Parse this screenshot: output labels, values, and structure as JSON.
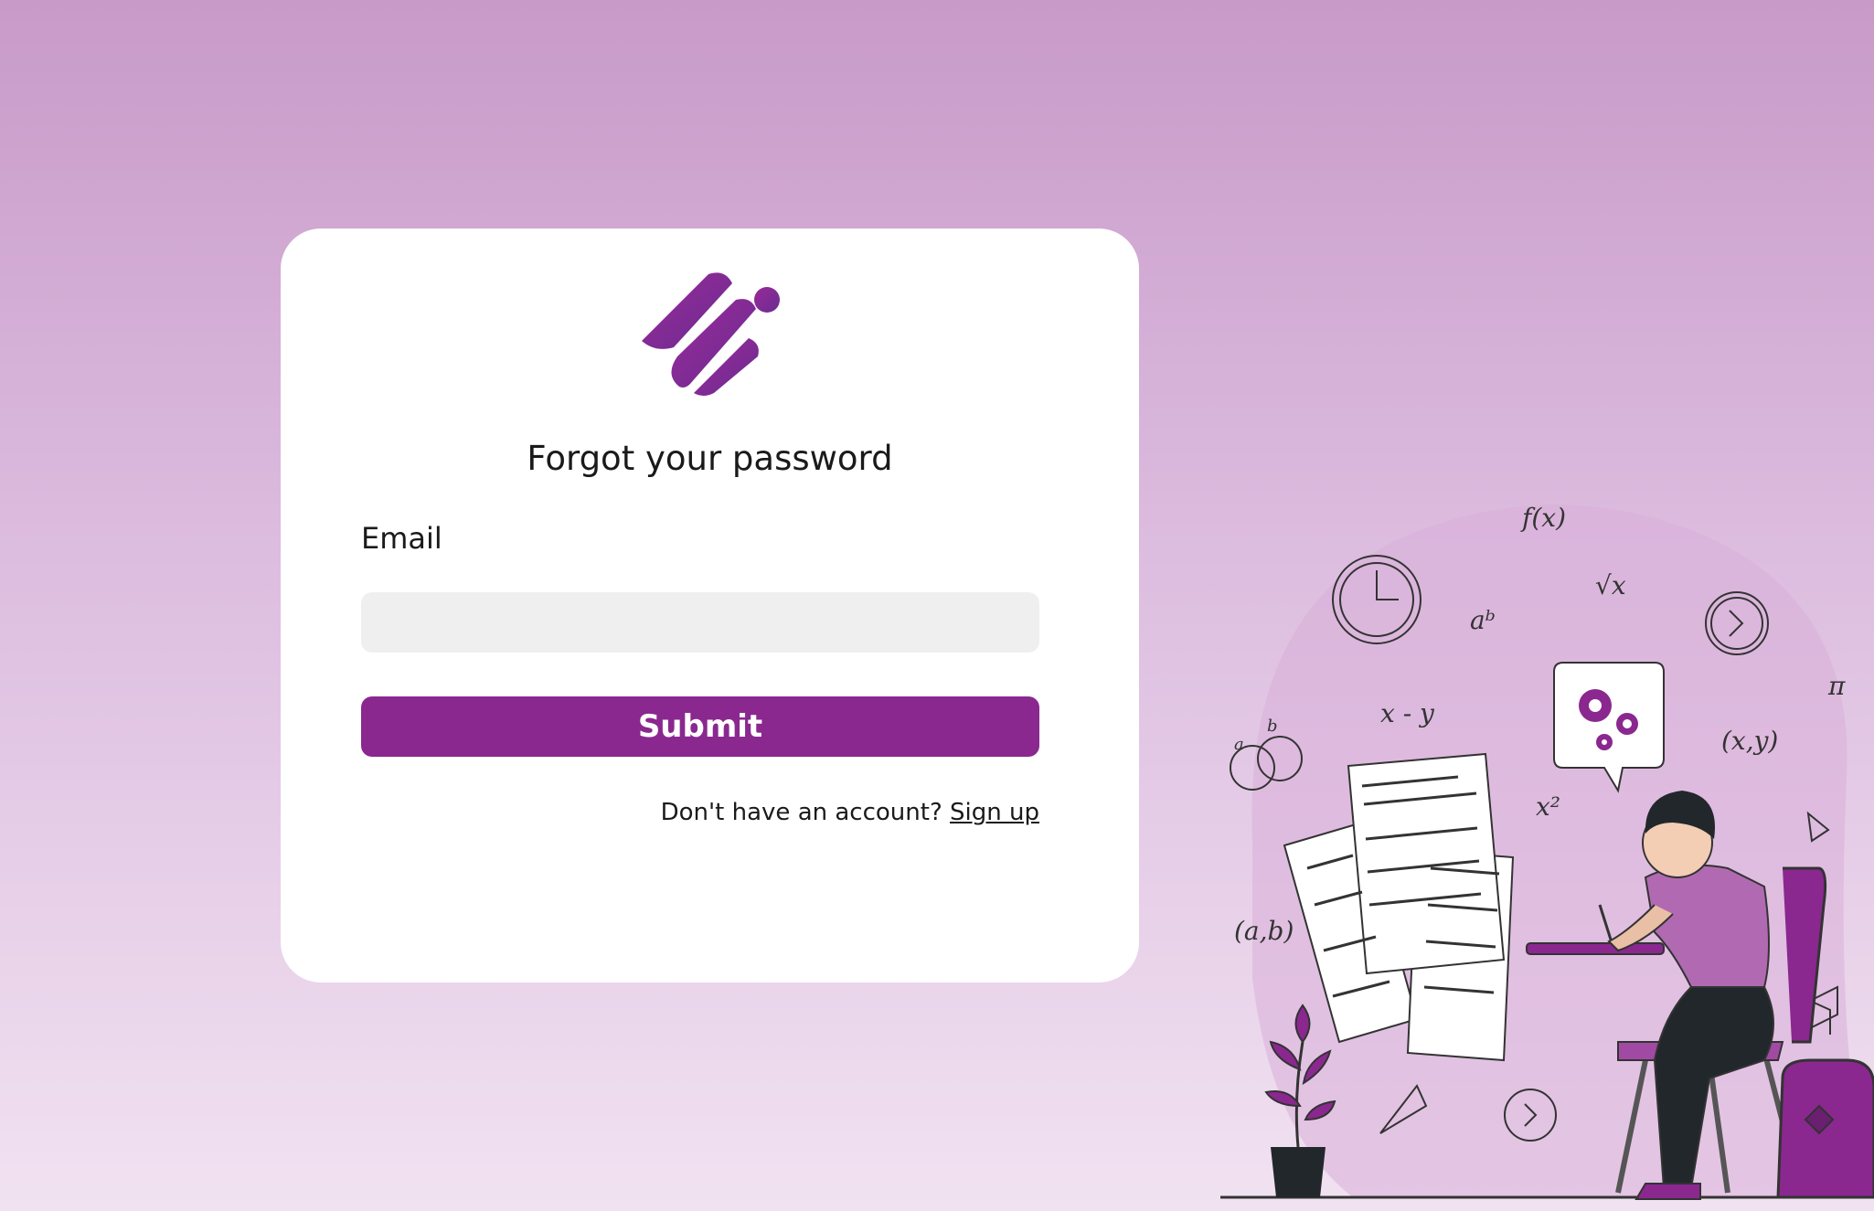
{
  "form": {
    "title": "Forgot your password",
    "email_label": "Email",
    "email_value": "",
    "email_placeholder": "",
    "submit_label": "Submit",
    "signup_prompt": "Don't have an account?",
    "signup_link": "Sign up"
  },
  "illustration": {
    "math_labels": [
      "f(x)",
      "a",
      "b",
      "aᵇ",
      "√x",
      "x - y",
      "π",
      "(x,y)",
      "x²",
      "(a,b)"
    ]
  },
  "colors": {
    "accent": "#8a288f",
    "card": "#ffffff",
    "input_bg": "#efefef"
  },
  "icons": {
    "logo": "brand-logo-icon",
    "illustration": "student-studying-illustration"
  }
}
